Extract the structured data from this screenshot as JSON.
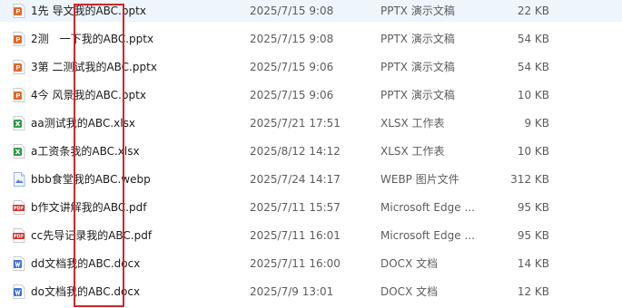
{
  "files": [
    {
      "name": "1先 导文我的ABC.pptx",
      "date": "2025/7/15 9:08",
      "type": "PPTX 演示文稿",
      "size": "22 KB",
      "icon": "pptx-icon"
    },
    {
      "name": "2测　一下我的ABC.pptx",
      "date": "2025/7/15 9:08",
      "type": "PPTX 演示文稿",
      "size": "54 KB",
      "icon": "pptx-icon"
    },
    {
      "name": "3第 二测试我的ABC.pptx",
      "date": "2025/7/15 9:06",
      "type": "PPTX 演示文稿",
      "size": "54 KB",
      "icon": "pptx-icon"
    },
    {
      "name": "4今 风景我的ABC.pptx",
      "date": "2025/7/15 9:06",
      "type": "PPTX 演示文稿",
      "size": "10 KB",
      "icon": "pptx-icon"
    },
    {
      "name": "aa测试我的ABC.xlsx",
      "date": "2025/7/21 17:51",
      "type": "XLSX 工作表",
      "size": "9 KB",
      "icon": "xlsx-icon"
    },
    {
      "name": "a工资条我的ABC.xlsx",
      "date": "2025/8/12 14:12",
      "type": "XLSX 工作表",
      "size": "10 KB",
      "icon": "xlsx-icon"
    },
    {
      "name": "bbb食堂我的ABC.webp",
      "date": "2025/7/24 14:17",
      "type": "WEBP 图片文件",
      "size": "312 KB",
      "icon": "webp-icon"
    },
    {
      "name": "b作文讲解我的ABC.pdf",
      "date": "2025/7/11 15:57",
      "type": "Microsoft Edge ...",
      "size": "95 KB",
      "icon": "pdf-icon"
    },
    {
      "name": "cc先导记录我的ABC.pdf",
      "date": "2025/7/11 16:01",
      "type": "Microsoft Edge ...",
      "size": "95 KB",
      "icon": "pdf-icon"
    },
    {
      "name": "dd文档我的ABC.docx",
      "date": "2025/7/11 16:00",
      "type": "DOCX 文档",
      "size": "14 KB",
      "icon": "docx-icon"
    },
    {
      "name": "do文档我的ABC.docx",
      "date": "2025/7/9 13:01",
      "type": "DOCX 文档",
      "size": "12 KB",
      "icon": "docx-icon"
    }
  ],
  "colors": {
    "pptx": "#e5672c",
    "xlsx": "#2f9a48",
    "webp": "#4f7ed8",
    "pdf": "#d0312d",
    "docx": "#3d6fd1",
    "highlight": "#d2262b"
  }
}
